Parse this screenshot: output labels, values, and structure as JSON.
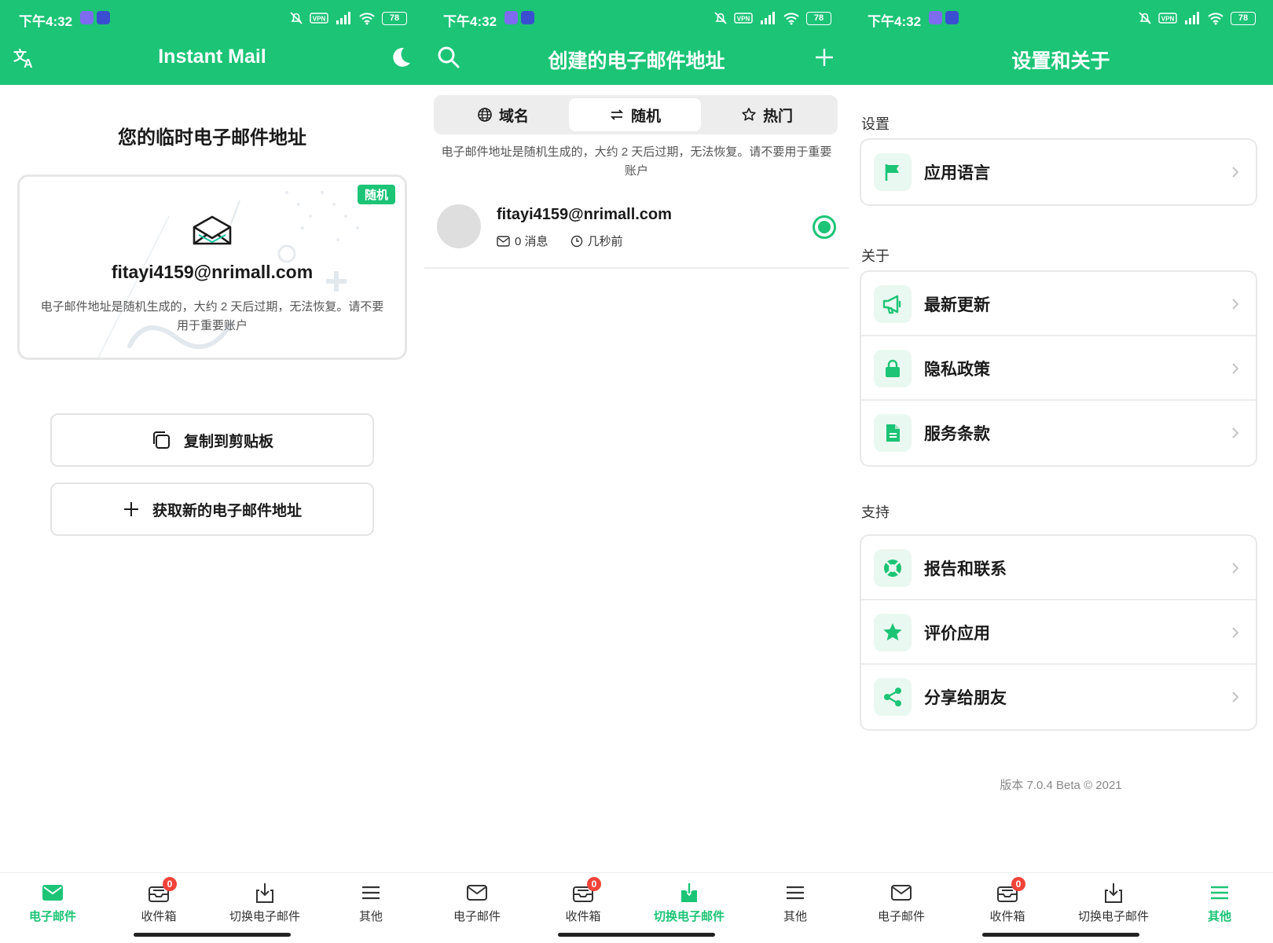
{
  "status": {
    "time": "下午4:32",
    "battery": "78",
    "vpn": "VPN"
  },
  "colors": {
    "accent": "#1cc476",
    "badge": "#f0443a"
  },
  "screen1": {
    "title": "Instant Mail",
    "heading": "您的临时电子邮件地址",
    "card": {
      "tag": "随机",
      "email": "fitayi4159@nrimall.com",
      "description": "电子邮件地址是随机生成的，大约 2 天后过期，无法恢复。请不要用于重要账户"
    },
    "copy_button": "复制到剪贴板",
    "new_button": "获取新的电子邮件地址"
  },
  "screen2": {
    "title": "创建的电子邮件地址",
    "tabs": [
      {
        "label": "域名",
        "icon": "globe-icon"
      },
      {
        "label": "随机",
        "icon": "swap-icon",
        "selected": true
      },
      {
        "label": "热门",
        "icon": "star-icon"
      }
    ],
    "description": "电子邮件地址是随机生成的，大约 2 天后过期，无法恢复。请不要用于重要账户",
    "emails": [
      {
        "address": "fitayi4159@nrimall.com",
        "messages": "0 消息",
        "time": "几秒前",
        "selected": true
      }
    ]
  },
  "screen3": {
    "title": "设置和关于",
    "sections": [
      {
        "label": "设置",
        "items": [
          {
            "label": "应用语言",
            "icon": "flag-icon"
          }
        ]
      },
      {
        "label": "关于",
        "items": [
          {
            "label": "最新更新",
            "icon": "megaphone-icon"
          },
          {
            "label": "隐私政策",
            "icon": "lock-icon"
          },
          {
            "label": "服务条款",
            "icon": "document-icon"
          }
        ]
      },
      {
        "label": "支持",
        "items": [
          {
            "label": "报告和联系",
            "icon": "lifebuoy-icon"
          },
          {
            "label": "评价应用",
            "icon": "star-icon"
          },
          {
            "label": "分享给朋友",
            "icon": "share-icon"
          }
        ]
      }
    ],
    "version": "版本 7.0.4 Beta © 2021"
  },
  "nav": {
    "items": [
      {
        "label": "电子邮件",
        "icon": "mail-icon"
      },
      {
        "label": "收件箱",
        "icon": "inbox-icon",
        "badge": "0"
      },
      {
        "label": "切换电子邮件",
        "icon": "download-icon"
      },
      {
        "label": "其他",
        "icon": "menu-icon"
      }
    ]
  }
}
